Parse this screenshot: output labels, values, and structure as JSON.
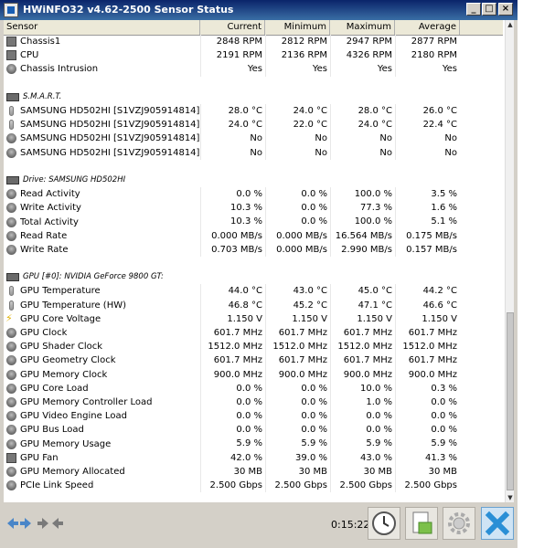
{
  "window": {
    "title": "HWiNFO32 v4.62-2500 Sensor Status"
  },
  "columns": [
    "Sensor",
    "Current",
    "Minimum",
    "Maximum",
    "Average"
  ],
  "rows": [
    {
      "kind": "sensor",
      "icon": "fan-icon",
      "label": "Chassis1",
      "cur": "2848 RPM",
      "min": "2812 RPM",
      "max": "2947 RPM",
      "avg": "2877 RPM"
    },
    {
      "kind": "sensor",
      "icon": "fan-icon",
      "label": "CPU",
      "cur": "2191 RPM",
      "min": "2136 RPM",
      "max": "4326 RPM",
      "avg": "2180 RPM"
    },
    {
      "kind": "sensor",
      "icon": "gauge-icon",
      "label": "Chassis Intrusion",
      "cur": "Yes",
      "min": "Yes",
      "max": "Yes",
      "avg": "Yes"
    },
    {
      "kind": "blank"
    },
    {
      "kind": "group",
      "icon": "drive-icon",
      "label": "S.M.A.R.T."
    },
    {
      "kind": "sensor",
      "icon": "thermometer-icon",
      "label": "SAMSUNG HD502HI [S1VZJ905914814]",
      "cur": "28.0 °C",
      "min": "24.0 °C",
      "max": "28.0 °C",
      "avg": "26.0 °C"
    },
    {
      "kind": "sensor",
      "icon": "thermometer-icon",
      "label": "SAMSUNG HD502HI [S1VZJ905914814] Ai...",
      "cur": "24.0 °C",
      "min": "22.0 °C",
      "max": "24.0 °C",
      "avg": "22.4 °C"
    },
    {
      "kind": "sensor",
      "icon": "gauge-icon",
      "label": "SAMSUNG HD502HI [S1VZJ905914814] Dr...",
      "cur": "No",
      "min": "No",
      "max": "No",
      "avg": "No"
    },
    {
      "kind": "sensor",
      "icon": "gauge-icon",
      "label": "SAMSUNG HD502HI [S1VZJ905914814] Dr...",
      "cur": "No",
      "min": "No",
      "max": "No",
      "avg": "No"
    },
    {
      "kind": "blank"
    },
    {
      "kind": "group",
      "icon": "drive-icon",
      "label": "Drive: SAMSUNG HD502HI"
    },
    {
      "kind": "sensor",
      "icon": "gauge-icon",
      "label": "Read Activity",
      "cur": "0.0 %",
      "min": "0.0 %",
      "max": "100.0 %",
      "avg": "3.5 %"
    },
    {
      "kind": "sensor",
      "icon": "gauge-icon",
      "label": "Write Activity",
      "cur": "10.3 %",
      "min": "0.0 %",
      "max": "77.3 %",
      "avg": "1.6 %"
    },
    {
      "kind": "sensor",
      "icon": "gauge-icon",
      "label": "Total Activity",
      "cur": "10.3 %",
      "min": "0.0 %",
      "max": "100.0 %",
      "avg": "5.1 %"
    },
    {
      "kind": "sensor",
      "icon": "gauge-icon",
      "label": "Read Rate",
      "cur": "0.000 MB/s",
      "min": "0.000 MB/s",
      "max": "16.564 MB/s",
      "avg": "0.175 MB/s"
    },
    {
      "kind": "sensor",
      "icon": "gauge-icon",
      "label": "Write Rate",
      "cur": "0.703 MB/s",
      "min": "0.000 MB/s",
      "max": "2.990 MB/s",
      "avg": "0.157 MB/s"
    },
    {
      "kind": "blank"
    },
    {
      "kind": "group",
      "icon": "gpu-icon",
      "label": "GPU [#0]: NVIDIA GeForce 9800 GT:"
    },
    {
      "kind": "sensor",
      "icon": "thermometer-icon",
      "label": "GPU Temperature",
      "cur": "44.0 °C",
      "min": "43.0 °C",
      "max": "45.0 °C",
      "avg": "44.2 °C"
    },
    {
      "kind": "sensor",
      "icon": "thermometer-icon",
      "label": "GPU Temperature (HW)",
      "cur": "46.8 °C",
      "min": "45.2 °C",
      "max": "47.1 °C",
      "avg": "46.6 °C"
    },
    {
      "kind": "sensor",
      "icon": "bolt-icon",
      "label": "GPU Core Voltage",
      "cur": "1.150 V",
      "min": "1.150 V",
      "max": "1.150 V",
      "avg": "1.150 V"
    },
    {
      "kind": "sensor",
      "icon": "gauge-icon",
      "label": "GPU Clock",
      "cur": "601.7 MHz",
      "min": "601.7 MHz",
      "max": "601.7 MHz",
      "avg": "601.7 MHz"
    },
    {
      "kind": "sensor",
      "icon": "gauge-icon",
      "label": "GPU Shader Clock",
      "cur": "1512.0 MHz",
      "min": "1512.0 MHz",
      "max": "1512.0 MHz",
      "avg": "1512.0 MHz"
    },
    {
      "kind": "sensor",
      "icon": "gauge-icon",
      "label": "GPU Geometry Clock",
      "cur": "601.7 MHz",
      "min": "601.7 MHz",
      "max": "601.7 MHz",
      "avg": "601.7 MHz"
    },
    {
      "kind": "sensor",
      "icon": "gauge-icon",
      "label": "GPU Memory Clock",
      "cur": "900.0 MHz",
      "min": "900.0 MHz",
      "max": "900.0 MHz",
      "avg": "900.0 MHz"
    },
    {
      "kind": "sensor",
      "icon": "gauge-icon",
      "label": "GPU Core Load",
      "cur": "0.0 %",
      "min": "0.0 %",
      "max": "10.0 %",
      "avg": "0.3 %"
    },
    {
      "kind": "sensor",
      "icon": "gauge-icon",
      "label": "GPU Memory Controller Load",
      "cur": "0.0 %",
      "min": "0.0 %",
      "max": "1.0 %",
      "avg": "0.0 %"
    },
    {
      "kind": "sensor",
      "icon": "gauge-icon",
      "label": "GPU Video Engine Load",
      "cur": "0.0 %",
      "min": "0.0 %",
      "max": "0.0 %",
      "avg": "0.0 %"
    },
    {
      "kind": "sensor",
      "icon": "gauge-icon",
      "label": "GPU Bus Load",
      "cur": "0.0 %",
      "min": "0.0 %",
      "max": "0.0 %",
      "avg": "0.0 %"
    },
    {
      "kind": "sensor",
      "icon": "gauge-icon",
      "label": "GPU Memory Usage",
      "cur": "5.9 %",
      "min": "5.9 %",
      "max": "5.9 %",
      "avg": "5.9 %"
    },
    {
      "kind": "sensor",
      "icon": "fan-icon",
      "label": "GPU Fan",
      "cur": "42.0 %",
      "min": "39.0 %",
      "max": "43.0 %",
      "avg": "41.3 %"
    },
    {
      "kind": "sensor",
      "icon": "gauge-icon",
      "label": "GPU Memory Allocated",
      "cur": "30 MB",
      "min": "30 MB",
      "max": "30 MB",
      "avg": "30 MB"
    },
    {
      "kind": "sensor",
      "icon": "gauge-icon",
      "label": "PCIe Link Speed",
      "cur": "2.500 Gbps",
      "min": "2.500 Gbps",
      "max": "2.500 Gbps",
      "avg": "2.500 Gbps"
    }
  ],
  "footer": {
    "elapsed_time": "0:15:22"
  },
  "colors": {
    "titlebar": "#0a246a",
    "close_button": "#2a8fd6"
  }
}
